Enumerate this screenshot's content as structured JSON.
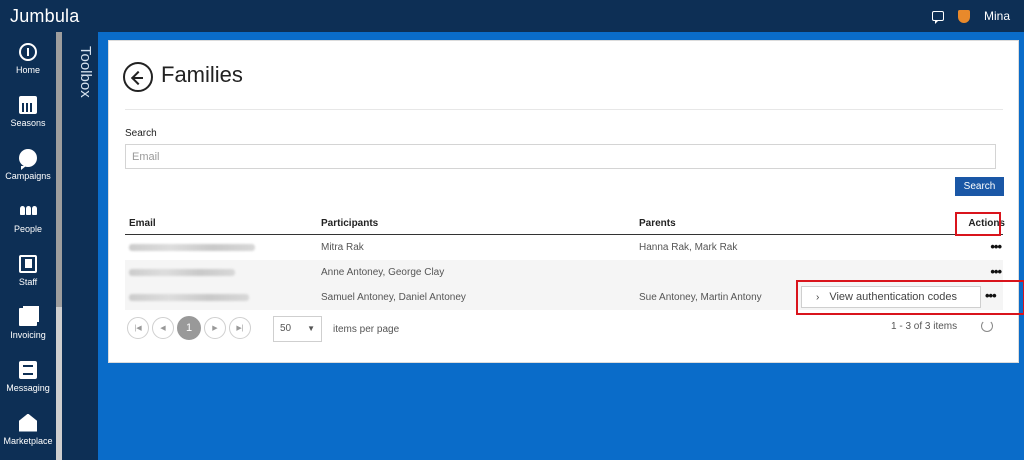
{
  "app": {
    "brand": "Jumbula"
  },
  "header": {
    "user_name": "Mina",
    "chat_icon": "chat-icon",
    "user_icon": "shield-icon",
    "accent": "#e8892b"
  },
  "nav": {
    "items": [
      {
        "label": "Home",
        "icon": "home-icon"
      },
      {
        "label": "Seasons",
        "icon": "calendar-icon"
      },
      {
        "label": "Campaigns",
        "icon": "speech-bubble-icon"
      },
      {
        "label": "People",
        "icon": "people-icon"
      },
      {
        "label": "Staff",
        "icon": "staff-icon"
      },
      {
        "label": "Invoicing",
        "icon": "invoice-icon"
      },
      {
        "label": "Messaging",
        "icon": "message-icon"
      },
      {
        "label": "Marketplace",
        "icon": "marketplace-icon"
      }
    ]
  },
  "toolbox": {
    "label": "Toolbox"
  },
  "page": {
    "title": "Families"
  },
  "search": {
    "label": "Search",
    "placeholder": "Email",
    "value": "",
    "button_label": "Search"
  },
  "grid": {
    "columns": [
      "Email",
      "Participants",
      "Parents",
      "Actions"
    ],
    "rows": [
      {
        "email": "",
        "participants": "Mitra Rak",
        "parents": "Hanna Rak, Mark Rak"
      },
      {
        "email": "",
        "participants": "Anne Antoney, George Clay",
        "parents": ""
      },
      {
        "email": "",
        "participants": "Samuel Antoney, Daniel Antoney",
        "parents": "Sue Antoney, Martin Antony"
      }
    ]
  },
  "action_menu": {
    "items": [
      "View authentication codes"
    ]
  },
  "pager": {
    "current_page": "1",
    "page_size": "50",
    "items_per_page_label": "items per page",
    "count_text": "1 - 3 of 3 items"
  },
  "colors": {
    "topbar": "#0d2f55",
    "background": "#0a6cc9",
    "button": "#1a57a6",
    "highlight": "#d9141c"
  }
}
